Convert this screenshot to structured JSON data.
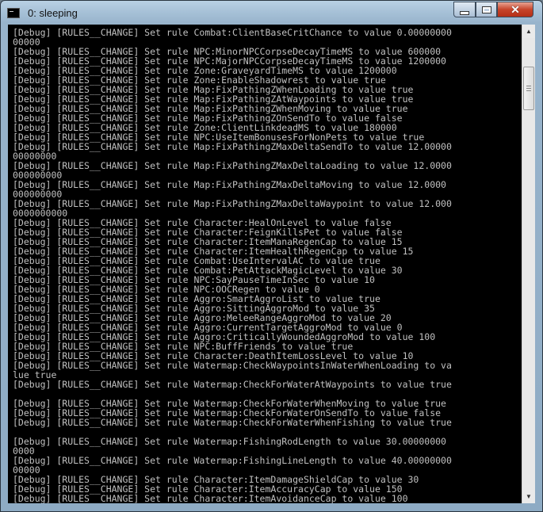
{
  "window": {
    "title": "0: sleeping"
  },
  "controls": {
    "minimize": "minimize",
    "maximize": "maximize",
    "close": "✕"
  },
  "scrollbar": {
    "up_arrow": "▲",
    "down_arrow": "▼"
  },
  "console": {
    "lines": [
      "[Debug] [RULES__CHANGE] Set rule Combat:ClientBaseCritChance to value 0.00000000",
      "00000",
      "[Debug] [RULES__CHANGE] Set rule NPC:MinorNPCCorpseDecayTimeMS to value 600000",
      "[Debug] [RULES__CHANGE] Set rule NPC:MajorNPCCorpseDecayTimeMS to value 1200000",
      "[Debug] [RULES__CHANGE] Set rule Zone:GraveyardTimeMS to value 1200000",
      "[Debug] [RULES__CHANGE] Set rule Zone:EnableShadowrest to value true",
      "[Debug] [RULES__CHANGE] Set rule Map:FixPathingZWhenLoading to value true",
      "[Debug] [RULES__CHANGE] Set rule Map:FixPathingZAtWaypoints to value true",
      "[Debug] [RULES__CHANGE] Set rule Map:FixPathingZWhenMoving to value true",
      "[Debug] [RULES__CHANGE] Set rule Map:FixPathingZOnSendTo to value false",
      "[Debug] [RULES__CHANGE] Set rule Zone:ClientLinkdeadMS to value 180000",
      "[Debug] [RULES__CHANGE] Set rule NPC:UseItemBonusesForNonPets to value true",
      "[Debug] [RULES__CHANGE] Set rule Map:FixPathingZMaxDeltaSendTo to value 12.00000",
      "00000000",
      "[Debug] [RULES__CHANGE] Set rule Map:FixPathingZMaxDeltaLoading to value 12.0000",
      "000000000",
      "[Debug] [RULES__CHANGE] Set rule Map:FixPathingZMaxDeltaMoving to value 12.0000",
      "000000000",
      "[Debug] [RULES__CHANGE] Set rule Map:FixPathingZMaxDeltaWaypoint to value 12.000",
      "0000000000",
      "[Debug] [RULES__CHANGE] Set rule Character:HealOnLevel to value false",
      "[Debug] [RULES__CHANGE] Set rule Character:FeignKillsPet to value false",
      "[Debug] [RULES__CHANGE] Set rule Character:ItemManaRegenCap to value 15",
      "[Debug] [RULES__CHANGE] Set rule Character:ItemHealthRegenCap to value 15",
      "[Debug] [RULES__CHANGE] Set rule Combat:UseIntervalAC to value true",
      "[Debug] [RULES__CHANGE] Set rule Combat:PetAttackMagicLevel to value 30",
      "[Debug] [RULES__CHANGE] Set rule NPC:SayPauseTimeInSec to value 10",
      "[Debug] [RULES__CHANGE] Set rule NPC:OOCRegen to value 0",
      "[Debug] [RULES__CHANGE] Set rule Aggro:SmartAggroList to value true",
      "[Debug] [RULES__CHANGE] Set rule Aggro:SittingAggroMod to value 35",
      "[Debug] [RULES__CHANGE] Set rule Aggro:MeleeRangeAggroMod to value 20",
      "[Debug] [RULES__CHANGE] Set rule Aggro:CurrentTargetAggroMod to value 0",
      "[Debug] [RULES__CHANGE] Set rule Aggro:CriticallyWoundedAggroMod to value 100",
      "[Debug] [RULES__CHANGE] Set rule NPC:BuffFriends to value true",
      "[Debug] [RULES__CHANGE] Set rule Character:DeathItemLossLevel to value 10",
      "[Debug] [RULES__CHANGE] Set rule Watermap:CheckWaypointsInWaterWhenLoading to va",
      "lue true",
      "[Debug] [RULES__CHANGE] Set rule Watermap:CheckForWaterAtWaypoints to value true",
      "",
      "[Debug] [RULES__CHANGE] Set rule Watermap:CheckForWaterWhenMoving to value true",
      "[Debug] [RULES__CHANGE] Set rule Watermap:CheckForWaterOnSendTo to value false",
      "[Debug] [RULES__CHANGE] Set rule Watermap:CheckForWaterWhenFishing to value true",
      "",
      "[Debug] [RULES__CHANGE] Set rule Watermap:FishingRodLength to value 30.00000000",
      "0000",
      "[Debug] [RULES__CHANGE] Set rule Watermap:FishingLineLength to value 40.00000000",
      "00000",
      "[Debug] [RULES__CHANGE] Set rule Character:ItemDamageShieldCap to value 30",
      "[Debug] [RULES__CHANGE] Set rule Character:ItemAccuracyCap to value 150",
      "[Debug] [RULES__CHANGE] Set rule Character:ItemAvoidanceCap to value 100"
    ]
  }
}
